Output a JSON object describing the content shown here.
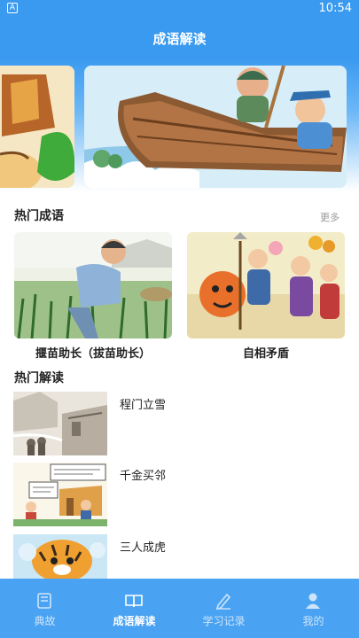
{
  "statusbar": {
    "badge": "A",
    "time": "10:54"
  },
  "header": {
    "title": "成语解读"
  },
  "hot_idioms": {
    "title": "热门成语",
    "more": "更多",
    "items": [
      {
        "label": "揠苗助长（拔苗助长）"
      },
      {
        "label": "自相矛盾"
      }
    ]
  },
  "hot_reads": {
    "title": "热门解读",
    "items": [
      {
        "title": "程门立雪"
      },
      {
        "title": "千金买邻"
      },
      {
        "title": "三人成虎"
      }
    ]
  },
  "tabs": [
    {
      "label": "典故",
      "icon": "book-icon",
      "active": false
    },
    {
      "label": "成语解读",
      "icon": "open-book-icon",
      "active": true
    },
    {
      "label": "学习记录",
      "icon": "pencil-icon",
      "active": false
    },
    {
      "label": "我的",
      "icon": "user-icon",
      "active": false
    }
  ],
  "colors": {
    "brand": "#3a9af0",
    "tabbar": "#4aa3f2"
  }
}
